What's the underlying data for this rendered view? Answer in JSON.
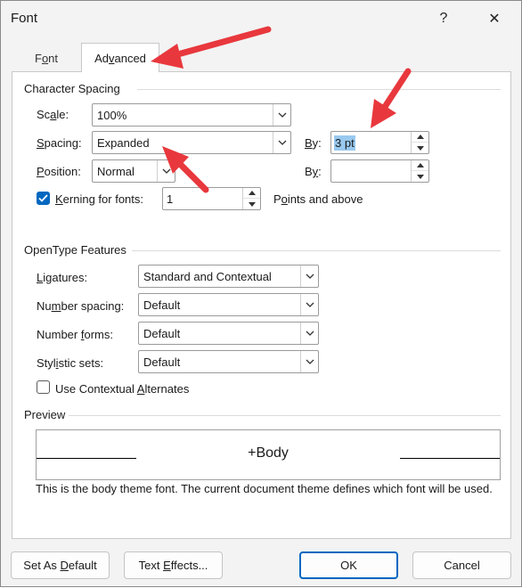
{
  "window": {
    "title": "Font",
    "help_label": "?",
    "close_label": "✕"
  },
  "tabs": [
    {
      "pre": "F",
      "acc": "o",
      "post": "nt"
    },
    {
      "pre": "Ad",
      "acc": "v",
      "post": "anced"
    }
  ],
  "character_spacing": {
    "title": "Character Spacing",
    "scale": {
      "pre": "Sc",
      "acc": "a",
      "post": "le:",
      "value": "100%"
    },
    "spacing": {
      "pre": "",
      "acc": "S",
      "post": "pacing:",
      "value": "Expanded"
    },
    "spacing_by": {
      "pre": "",
      "acc": "B",
      "post": "y:",
      "value": "3 pt"
    },
    "position": {
      "pre": "",
      "acc": "P",
      "post": "osition:",
      "value": "Normal"
    },
    "position_by": {
      "pre": "B",
      "acc": "y",
      "post": ":",
      "value": ""
    },
    "kerning": {
      "pre": "",
      "acc": "K",
      "post": "erning for fonts:",
      "value": "1",
      "checked": true
    },
    "points_above": {
      "pre": "P",
      "acc": "o",
      "post": "ints and above"
    }
  },
  "opentype": {
    "title": "OpenType Features",
    "ligatures": {
      "pre": "",
      "acc": "L",
      "post": "igatures:",
      "value": "Standard and Contextual"
    },
    "number_spacing": {
      "pre": "Nu",
      "acc": "m",
      "post": "ber spacing:",
      "value": "Default"
    },
    "number_forms": {
      "pre": "Number ",
      "acc": "f",
      "post": "orms:",
      "value": "Default"
    },
    "stylistic_sets": {
      "pre": "Styl",
      "acc": "i",
      "post": "stic sets:",
      "value": "Default"
    },
    "contextual_alternates": {
      "pre": "Use Contextual ",
      "acc": "A",
      "post": "lternates",
      "checked": false
    }
  },
  "preview": {
    "title": "Preview",
    "sample": "+Body",
    "description": "This is the body theme font. The current document theme defines which font will be used."
  },
  "buttons": {
    "set_default": {
      "pre": "Set As ",
      "acc": "D",
      "post": "efault"
    },
    "text_effects": {
      "pre": "Text ",
      "acc": "E",
      "post": "ffects..."
    },
    "ok": "OK",
    "cancel": "Cancel"
  },
  "colors": {
    "accent": "#0067c0",
    "annotation_arrow": "#e8383d",
    "selection": "#99c9ef"
  },
  "icons": {
    "help": "question-mark-icon",
    "close": "close-icon",
    "dropdown": "chevron-down-icon",
    "spin_up": "spin-up-icon",
    "spin_down": "spin-down-icon",
    "check": "checkmark-icon"
  }
}
